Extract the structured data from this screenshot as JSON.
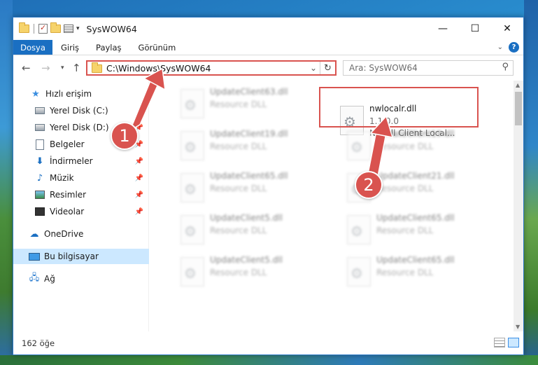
{
  "window": {
    "title": "SysWOW64"
  },
  "ribbon": {
    "tabs": [
      "Dosya",
      "Giriş",
      "Paylaş",
      "Görünüm"
    ]
  },
  "nav": {
    "address": "C:\\Windows\\SysWOW64",
    "search_placeholder": "Ara: SysWOW64"
  },
  "sidebar": {
    "items": [
      {
        "label": "Hızlı erişim"
      },
      {
        "label": "Yerel Disk (C:)"
      },
      {
        "label": "Yerel Disk (D:)"
      },
      {
        "label": "Belgeler"
      },
      {
        "label": "İndirmeler"
      },
      {
        "label": "Müzik"
      },
      {
        "label": "Resimler"
      },
      {
        "label": "Videolar"
      },
      {
        "label": "OneDrive"
      },
      {
        "label": "Bu bilgisayar"
      },
      {
        "label": "Ağ"
      }
    ]
  },
  "files": [
    {
      "name": "UpdateClient63.dll",
      "desc": "Resource DLL"
    },
    {
      "name": "UpdateClient19.dll",
      "desc": "Resource DLL"
    },
    {
      "name": "UpdateClient65.dll",
      "desc": "Resource DLL"
    },
    {
      "name": "UpdateClient5.dll",
      "desc": "Resource DLL"
    },
    {
      "name": "UpdateClient5.dll",
      "desc": "Resource DLL"
    },
    {
      "name": "UpdateClient19.dll",
      "desc": "Resource DLL"
    },
    {
      "name": "UpdateClient21.dll",
      "desc": "Resource DLL"
    },
    {
      "name": "UpdateClient65.dll",
      "desc": "Resource DLL"
    },
    {
      "name": "UpdateClient65.dll",
      "desc": "Resource DLL"
    }
  ],
  "highlighted_file": {
    "name": "nwlocalr.dll",
    "version": "1.1.0.0",
    "desc": "Novell Client Local..."
  },
  "status": {
    "count": "162 öğe"
  },
  "annotations": {
    "step1": "1",
    "step2": "2",
    "color": "#d9534f"
  }
}
